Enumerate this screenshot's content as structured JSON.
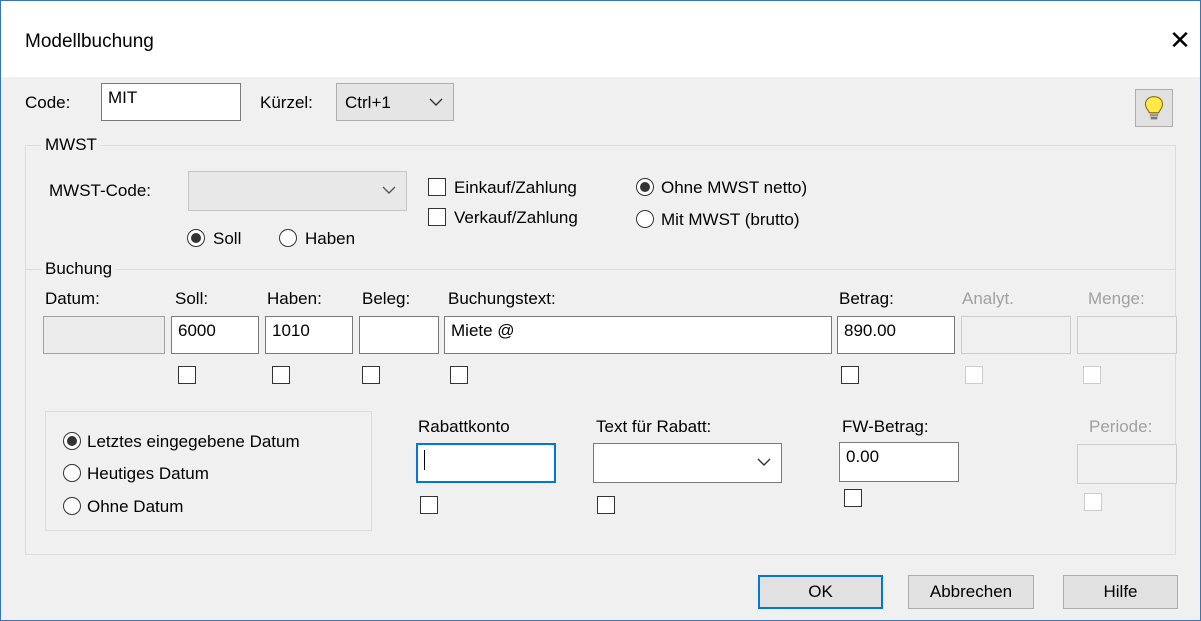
{
  "window": {
    "title": "Modellbuchung",
    "close_label": "✕"
  },
  "header": {
    "code_label": "Code:",
    "code_value": "MIT",
    "kuerzel_label": "Kürzel:",
    "kuerzel_value": "Ctrl+1"
  },
  "mwst": {
    "group_label": "MWST",
    "code_label": "MWST-Code:",
    "code_value": "",
    "soll_label": "Soll",
    "haben_label": "Haben",
    "einkauf_label": "Einkauf/Zahlung",
    "verkauf_label": "Verkauf/Zahlung",
    "ohne_label": "Ohne MWST netto)",
    "mit_label": "Mit MWST (brutto)"
  },
  "buchung": {
    "group_label": "Buchung",
    "datum_label": "Datum:",
    "soll_label": "Soll:",
    "haben_label": "Haben:",
    "beleg_label": "Beleg:",
    "text_label": "Buchungstext:",
    "betrag_label": "Betrag:",
    "analyt_label": "Analyt.",
    "menge_label": "Menge:",
    "datum_value": "",
    "soll_value": "6000",
    "haben_value": "1010",
    "beleg_value": "",
    "text_value": "Miete @",
    "betrag_value": "890.00"
  },
  "date_options": {
    "letztes_label": "Letztes eingegebene Datum",
    "heutiges_label": "Heutiges Datum",
    "ohne_label": "Ohne Datum"
  },
  "rabatt": {
    "konto_label": "Rabattkonto",
    "konto_value": "",
    "text_label": "Text für Rabatt:",
    "text_value": "",
    "fw_label": "FW-Betrag:",
    "fw_value": "0.00",
    "periode_label": "Periode:"
  },
  "buttons": {
    "ok": "OK",
    "cancel": "Abbrechen",
    "help": "Hilfe"
  },
  "colors": {
    "accent": "#0078d7",
    "dialog_bg": "#f0f0f0",
    "window_border": "#3a74b8"
  }
}
